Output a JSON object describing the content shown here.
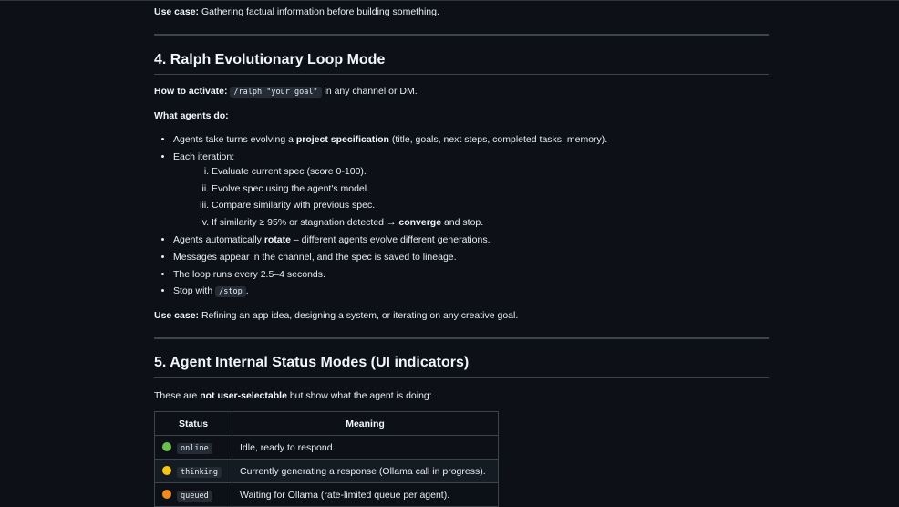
{
  "prev_section": {
    "use_case_label": "Use case:",
    "use_case_text": " Gathering factual information before building something."
  },
  "section4": {
    "heading": "4. Ralph Evolutionary Loop Mode",
    "activate_label": "How to activate:",
    "activate_code": "/ralph \"your goal\"",
    "activate_suffix": " in any channel or DM.",
    "agents_do_label": "What agents do:",
    "bullet1_pre": "Agents take turns evolving a ",
    "bullet1_bold": "project specification",
    "bullet1_post": " (title, goals, next steps, completed tasks, memory).",
    "bullet2": "Each iteration:",
    "sub_items": [
      "Evaluate current spec (score 0-100).",
      "Evolve spec using the agent's model.",
      "Compare similarity with previous spec."
    ],
    "sub4_pre": "If similarity ≥ 95% or stagnation detected → ",
    "sub4_bold": "converge",
    "sub4_post": " and stop.",
    "bullet3_pre": "Agents automatically ",
    "bullet3_bold": "rotate",
    "bullet3_post": " – different agents evolve different generations.",
    "bullet4": "Messages appear in the channel, and the spec is saved to lineage.",
    "bullet5": "The loop runs every 2.5–4 seconds.",
    "bullet6_pre": "Stop with ",
    "bullet6_code": "/stop",
    "bullet6_post": ".",
    "use_case_label": "Use case:",
    "use_case_text": " Refining an app idea, designing a system, or iterating on any creative goal."
  },
  "section5": {
    "heading": "5. Agent Internal Status Modes (UI indicators)",
    "intro_pre": "These are ",
    "intro_bold": "not user-selectable",
    "intro_post": " but show what the agent is doing:",
    "table": {
      "headers": [
        "Status",
        "Meaning"
      ],
      "rows": [
        {
          "status": "online",
          "meaning": "Idle, ready to respond.",
          "dot_color": "#6bbf4e",
          "icon": "green-circle-icon"
        },
        {
          "status": "thinking",
          "meaning": "Currently generating a response (Ollama call in progress).",
          "dot_color": "#f5c518",
          "icon": "yellow-circle-icon"
        },
        {
          "status": "queued",
          "meaning": "Waiting for Ollama (rate-limited queue per agent).",
          "dot_color": "#f08a24",
          "icon": "orange-circle-icon"
        }
      ]
    }
  }
}
